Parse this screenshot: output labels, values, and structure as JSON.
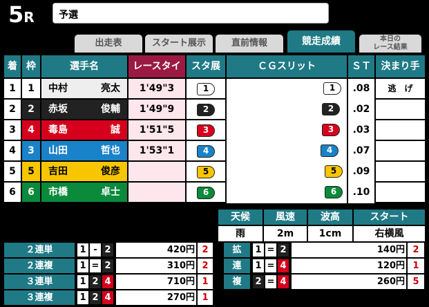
{
  "race": {
    "number": "5",
    "suffix": "R",
    "title": "予選"
  },
  "tabs": [
    {
      "label": "出走表"
    },
    {
      "label": "スタート展示"
    },
    {
      "label": "直前情報"
    },
    {
      "label": "競走成績"
    },
    {
      "label_line1": "本日の",
      "label_line2": "レース結果"
    }
  ],
  "result_headers": [
    "着",
    "枠",
    "選手名",
    "レースタイム",
    "スタ展",
    "ＣＧスリット",
    "ＳＴ",
    "決まり手"
  ],
  "waku_colors": [
    "#ffffff",
    "#222222",
    "#1a82c8",
    "#d6001c",
    "#f7c600",
    "#0a8a3a"
  ],
  "waku_text_colors": [
    "#000000",
    "#ffffff",
    "#ffffff",
    "#ffffff",
    "#000000",
    "#ffffff"
  ],
  "results": [
    {
      "rank": "1",
      "waku": "1",
      "sei": "中村",
      "mei": "亮太",
      "time": "1'49\"3",
      "sta": "1",
      "cg": "1",
      "st": ".08",
      "kimarite": "逃　げ"
    },
    {
      "rank": "2",
      "waku": "2",
      "sei": "赤坂",
      "mei": "俊輔",
      "time": "1'49\"9",
      "sta": "2",
      "cg": "2",
      "st": ".02",
      "kimarite": ""
    },
    {
      "rank": "3",
      "waku": "4",
      "sei": "毒島",
      "mei": "誠",
      "time": "1'51\"5",
      "sta": "3",
      "cg": "3",
      "st": ".03",
      "kimarite": ""
    },
    {
      "rank": "4",
      "waku": "3",
      "sei": "山田",
      "mei": "哲也",
      "time": "1'53\"1",
      "sta": "4",
      "cg": "4",
      "st": ".07",
      "kimarite": ""
    },
    {
      "rank": "5",
      "waku": "5",
      "sei": "吉田",
      "mei": "俊彦",
      "time": "",
      "sta": "5",
      "cg": "5",
      "st": ".09",
      "kimarite": ""
    },
    {
      "rank": "6",
      "waku": "6",
      "sei": "市橋",
      "mei": "卓士",
      "time": "",
      "sta": "6",
      "cg": "6",
      "st": ".10",
      "kimarite": ""
    }
  ],
  "weather": {
    "headers": [
      "天候",
      "風速",
      "波高",
      "スタート"
    ],
    "values": [
      "雨",
      "2m",
      "1cm",
      "右横風"
    ]
  },
  "payouts_left": [
    {
      "label": "２連単",
      "combo": [
        "1",
        "-",
        "2"
      ],
      "amount": "420円",
      "pop": "2"
    },
    {
      "label": "２連複",
      "combo": [
        "1",
        "=",
        "2"
      ],
      "amount": "310円",
      "pop": "2"
    },
    {
      "label": "３連単",
      "combo": [
        "1",
        "2",
        "4"
      ],
      "amount": "710円",
      "pop": "1"
    },
    {
      "label": "３連複",
      "combo": [
        "1",
        "2",
        "4"
      ],
      "amount": "270円",
      "pop": "1"
    }
  ],
  "payouts_right": [
    {
      "label": "拡",
      "combo": [
        "1",
        "=",
        "2"
      ],
      "amount": "140円",
      "pop": "2"
    },
    {
      "label": "連",
      "combo": [
        "1",
        "=",
        "4"
      ],
      "amount": "120円",
      "pop": "1"
    },
    {
      "label": "複",
      "combo": [
        "2",
        "=",
        "4"
      ],
      "amount": "260円",
      "pop": "5"
    }
  ]
}
